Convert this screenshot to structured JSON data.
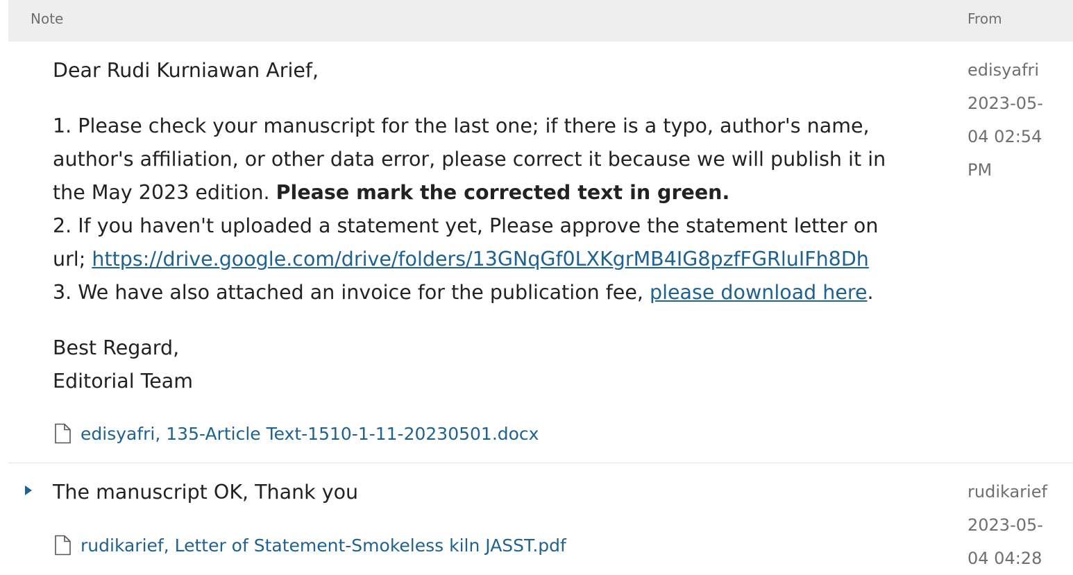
{
  "header": {
    "note_label": "Note",
    "from_label": "From"
  },
  "notes": [
    {
      "greeting": "Dear Rudi Kurniawan Arief,",
      "item1_a": "1. Please check your manuscript for the last one; if there is a typo, author's name,",
      "item1_b": "author's affiliation, or other data error, please correct it because we will publish it in",
      "item1_c": "the May 2023 edition. ",
      "item1_bold": "Please mark the corrected text in green.",
      "item2_a": "2. If you haven't uploaded a statement yet, Please approve the statement letter on",
      "item2_b_prefix": "url; ",
      "item2_link": "https://drive.google.com/drive/folders/13GNqGf0LXKgrMB4IG8pzfFGRluIFh8Dh",
      "item3_prefix": "3. We have also attached an invoice for the publication fee, ",
      "item3_link": "please download here",
      "item3_suffix": ".",
      "signoff_1": "Best Regard,",
      "signoff_2": "Editorial Team",
      "attachment": "edisyafri, 135-Article Text-1510-1-11-20230501.docx",
      "from_user": "edisyafri",
      "from_date_1": "2023-05-",
      "from_date_2": "04 02:54",
      "from_date_3": "PM"
    },
    {
      "text": "The manuscript OK, Thank you",
      "attachment": "rudikarief, Letter of Statement-Smokeless kiln JASST.pdf",
      "from_user": "rudikarief",
      "from_date_1": "2023-05-",
      "from_date_2": "04 04:28"
    }
  ],
  "icons": {
    "file": "file-icon",
    "expand": "caret-right-icon"
  },
  "colors": {
    "link": "#1e6292",
    "header_bg": "#eeeeee",
    "muted": "#6f6f6f"
  }
}
